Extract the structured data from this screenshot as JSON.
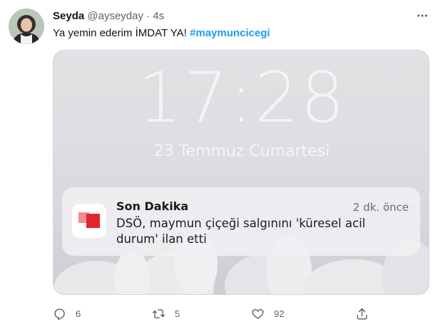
{
  "tweet": {
    "author": {
      "name": "Seyda",
      "handle": "@ayseyday",
      "separator": "·",
      "time": "4s"
    },
    "text": "Ya yemin ederim İMDAT YA!",
    "hashtag": "#maymuncicegi",
    "media": {
      "lock_screen": {
        "time": "17:28",
        "date": "23 Temmuz Cumartesi"
      },
      "notification": {
        "app": "Son Dakika",
        "time": "2 dk. önce",
        "body": "DSÖ, maymun çiçeği salgınını 'küresel acil durum' ilan etti"
      }
    },
    "actions": {
      "reply": {
        "icon": "reply-icon",
        "count": "6"
      },
      "retweet": {
        "icon": "retweet-icon",
        "count": "5"
      },
      "like": {
        "icon": "heart-icon",
        "count": "92"
      },
      "share": {
        "icon": "share-icon"
      }
    }
  },
  "colors": {
    "link": "#1d9bf0",
    "secondary_text": "#536471",
    "primary_text": "#0f1419",
    "app_icon_red": "#e0252b"
  }
}
